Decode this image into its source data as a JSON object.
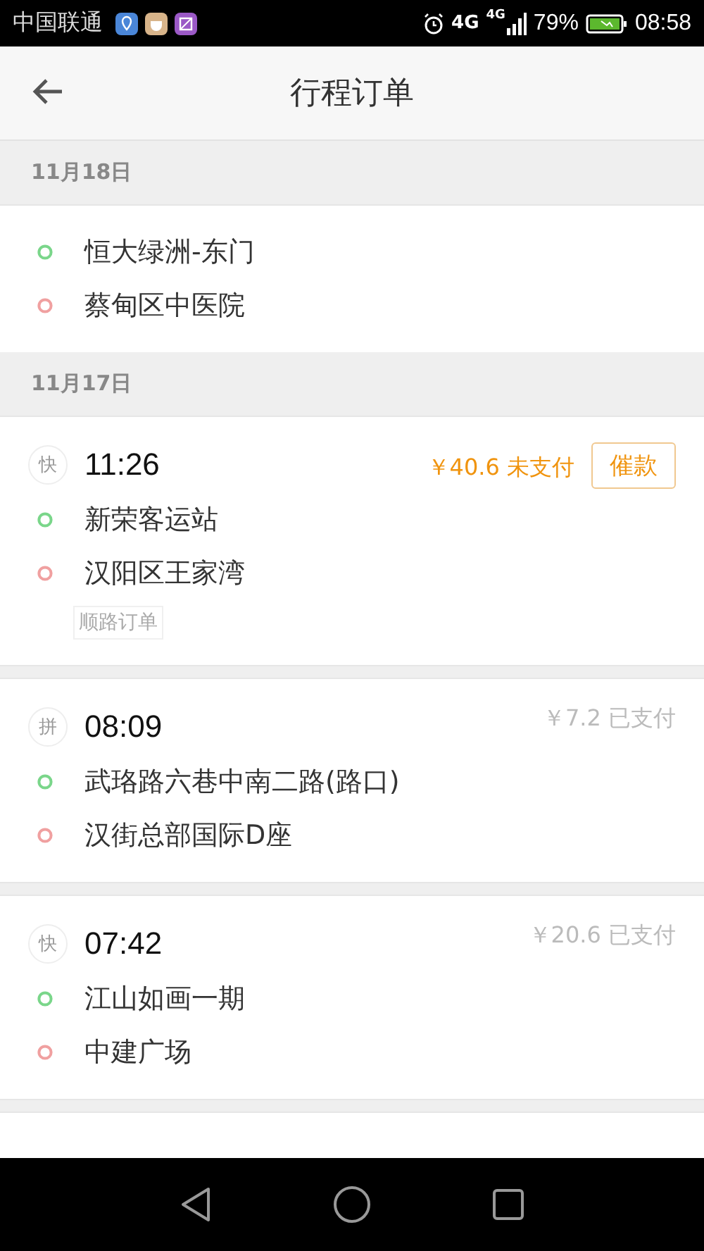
{
  "status_bar": {
    "carrier": "中国联通",
    "network": "4G",
    "network_2": "4G",
    "battery_percent": "79%",
    "time": "08:58"
  },
  "header": {
    "title": "行程订单"
  },
  "groups": [
    {
      "date": "11月18日",
      "orders": [
        {
          "from": "恒大绿洲-东门",
          "to": "蔡甸区中医院"
        }
      ]
    },
    {
      "date": "11月17日",
      "orders": [
        {
          "type": "快",
          "time": "11:26",
          "price": "￥40.6 未支付",
          "paid": false,
          "action": "催款",
          "tag": "顺路订单",
          "from": "新荣客运站",
          "to": "汉阳区王家湾"
        },
        {
          "type": "拼",
          "time": "08:09",
          "price": "￥7.2 已支付",
          "paid": true,
          "from": "武珞路六巷中南二路(路口)",
          "to": "汉街总部国际D座"
        },
        {
          "type": "快",
          "time": "07:42",
          "price": "￥20.6 已支付",
          "paid": true,
          "from": "江山如画一期",
          "to": "中建广场"
        }
      ]
    }
  ]
}
